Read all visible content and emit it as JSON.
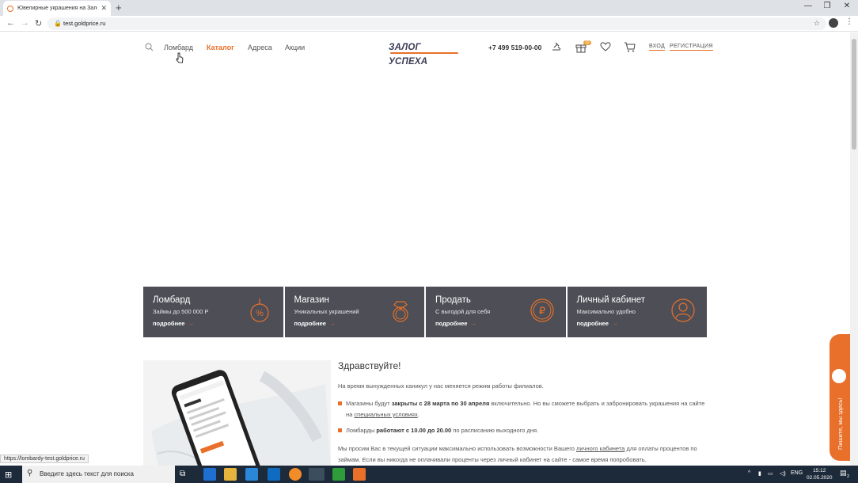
{
  "browser": {
    "tab_title": "Ювелирные украшения на Залог",
    "url": "test.goldprice.ru",
    "status_url": "https://lombardy-test.goldprice.ru"
  },
  "header": {
    "nav": [
      "Ломбард",
      "Каталог",
      "Адреса",
      "Акции"
    ],
    "active_nav": "Каталог",
    "logo_text": "ЗАЛОГ УСПЕХА",
    "phone": "+7 499 519-00-00",
    "login": "ВХОД",
    "register": "РЕГИСТРАЦИЯ",
    "gift_badge": "10"
  },
  "cards": [
    {
      "title": "Ломбард",
      "subtitle": "Займы до 500 000 Р",
      "more": "подробнее",
      "icon": "percent-drop-icon"
    },
    {
      "title": "Магазин",
      "subtitle": "Уникальных украшений",
      "more": "подробнее",
      "icon": "ring-icon"
    },
    {
      "title": "Продать",
      "subtitle": "С выгодой для себя",
      "more": "подробнее",
      "icon": "ruble-coin-icon"
    },
    {
      "title": "Личный кабинет",
      "subtitle": "Максимально удобно",
      "more": "подробнее",
      "icon": "user-icon"
    }
  ],
  "content": {
    "greeting": "Здравствуйте!",
    "intro": "На время вынужденных каникул у нас меняется режим работы филиалов.",
    "item1_a": "Магазины будут ",
    "item1_b": "закрыты с 28 марта по 30 апреля",
    "item1_c": " включительно. Но вы сможете выбрать и забронировать украшения на сайте на ",
    "item1_link": "специальных условиях",
    "item1_d": ".",
    "item2_a": "Ломбарды ",
    "item2_b": "работают с 10.00 до 20.00",
    "item2_c": " по расписанию выходного дня.",
    "para_a": "Мы просим Вас в текущей ситуации максимально использовать возможности Вашего ",
    "para_link": "личного кабинета",
    "para_b": " для оплаты процентов по займам. Если вы никогда не оплачивали проценты через личный кабинет на сайте - самое время попробовать."
  },
  "chat_widget": "Пишите, мы здесь!",
  "taskbar": {
    "search_placeholder": "Введите здесь текст для поиска",
    "lang": "ENG",
    "time": "15:12",
    "date": "02.05.2020",
    "notif_count": "2"
  },
  "colors": {
    "accent": "#e8702a",
    "card_bg": "#4d4e56",
    "taskbar": "#1d2a3a"
  }
}
